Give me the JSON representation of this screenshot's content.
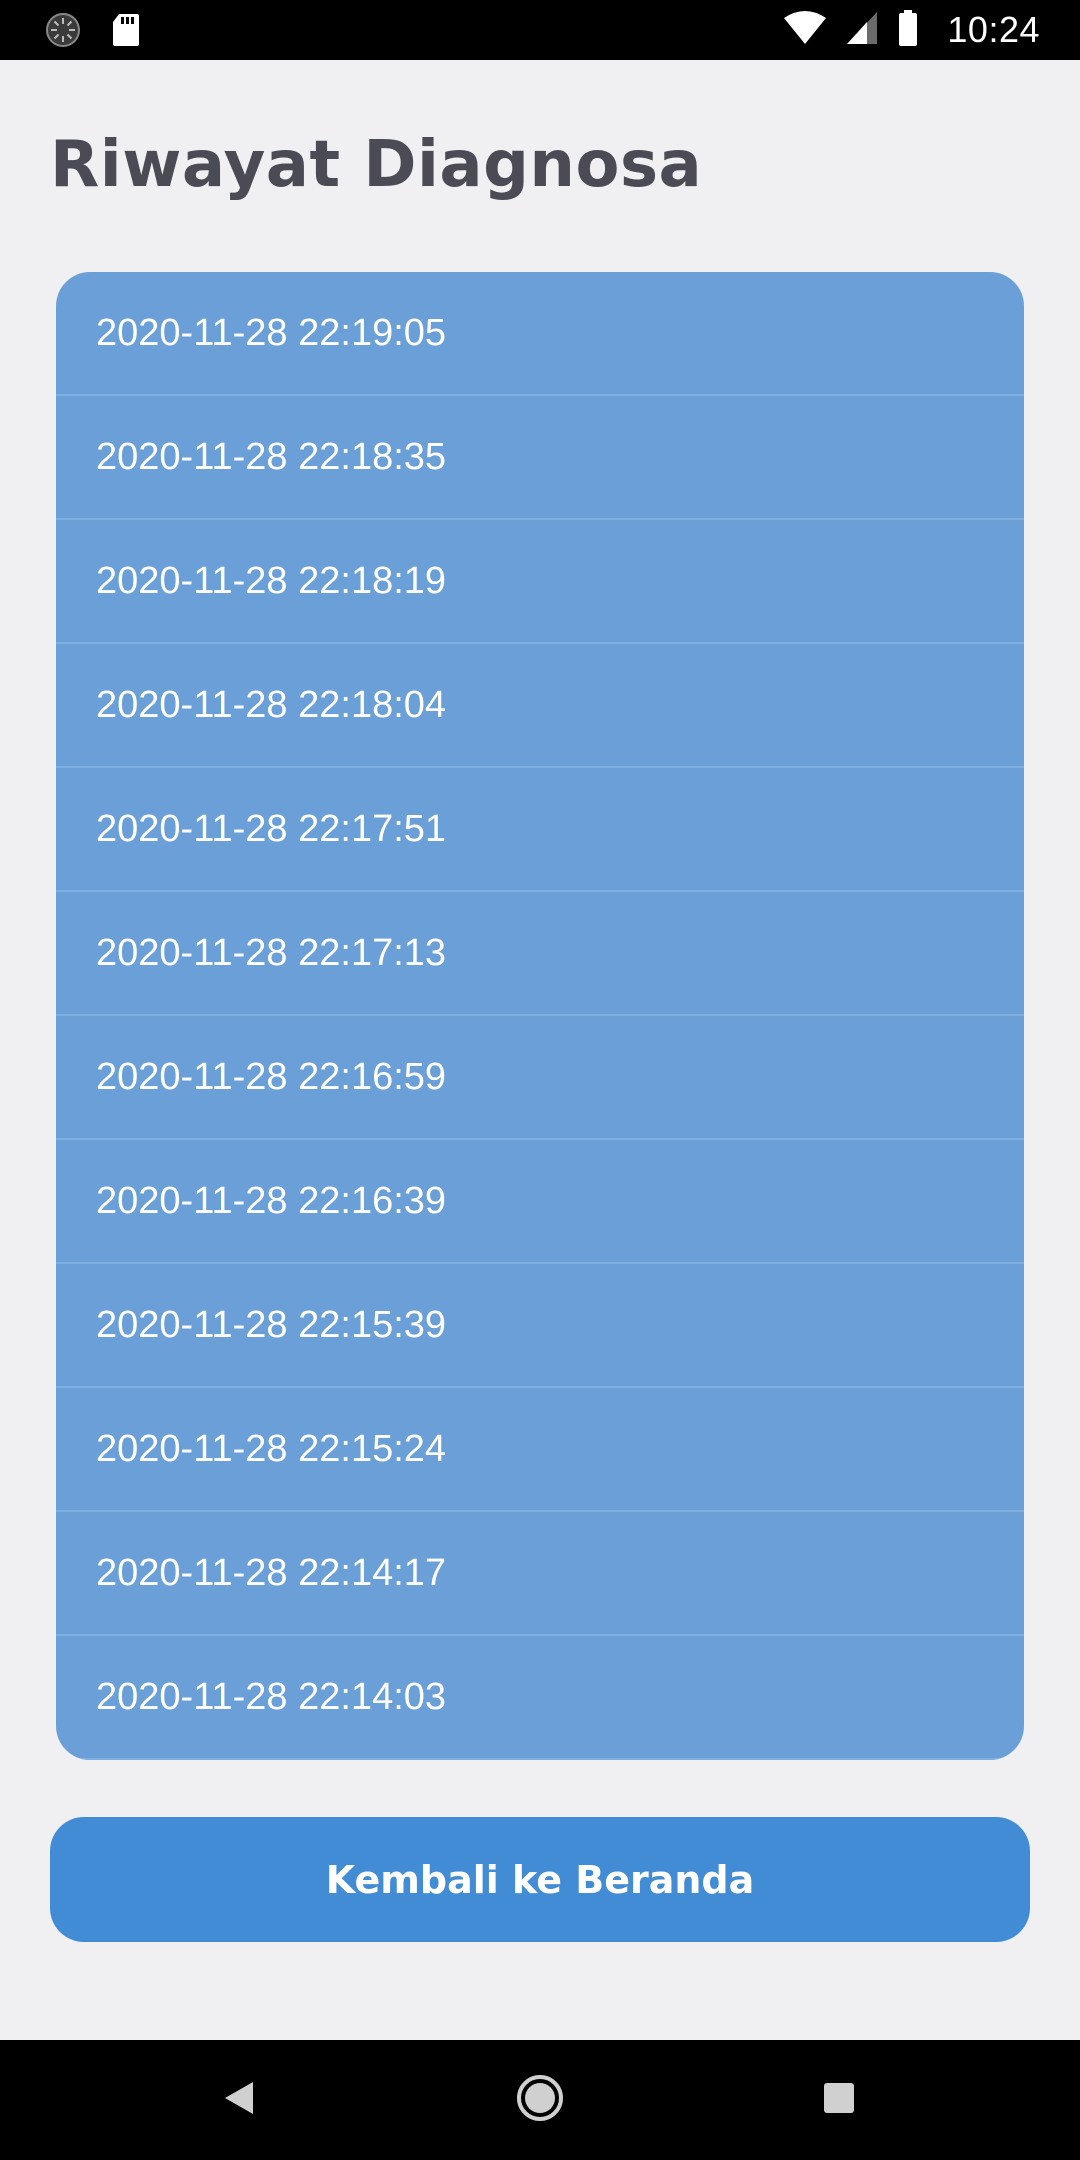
{
  "status_bar": {
    "time": "10:24",
    "left_icons": [
      "loading-icon",
      "sd-card-icon"
    ],
    "right_icons": [
      "wifi-icon",
      "signal-icon",
      "battery-icon"
    ]
  },
  "page": {
    "title": "Riwayat Diagnosa"
  },
  "history": {
    "items": [
      {
        "timestamp": "2020-11-28 22:19:05"
      },
      {
        "timestamp": "2020-11-28 22:18:35"
      },
      {
        "timestamp": "2020-11-28 22:18:19"
      },
      {
        "timestamp": "2020-11-28 22:18:04"
      },
      {
        "timestamp": "2020-11-28 22:17:51"
      },
      {
        "timestamp": "2020-11-28 22:17:13"
      },
      {
        "timestamp": "2020-11-28 22:16:59"
      },
      {
        "timestamp": "2020-11-28 22:16:39"
      },
      {
        "timestamp": "2020-11-28 22:15:39"
      },
      {
        "timestamp": "2020-11-28 22:15:24"
      },
      {
        "timestamp": "2020-11-28 22:14:17"
      },
      {
        "timestamp": "2020-11-28 22:14:03"
      }
    ]
  },
  "actions": {
    "back_label": "Kembali ke Beranda"
  },
  "nav_bar": {
    "buttons": [
      "back-triangle-icon",
      "home-circle-icon",
      "recents-square-icon"
    ]
  },
  "colors": {
    "background": "#f0f0f2",
    "title": "#4a4b55",
    "card": "#6a9fd8",
    "divider": "#7fb0e3",
    "button": "#428bd5",
    "text_on_blue": "#ffffff"
  }
}
